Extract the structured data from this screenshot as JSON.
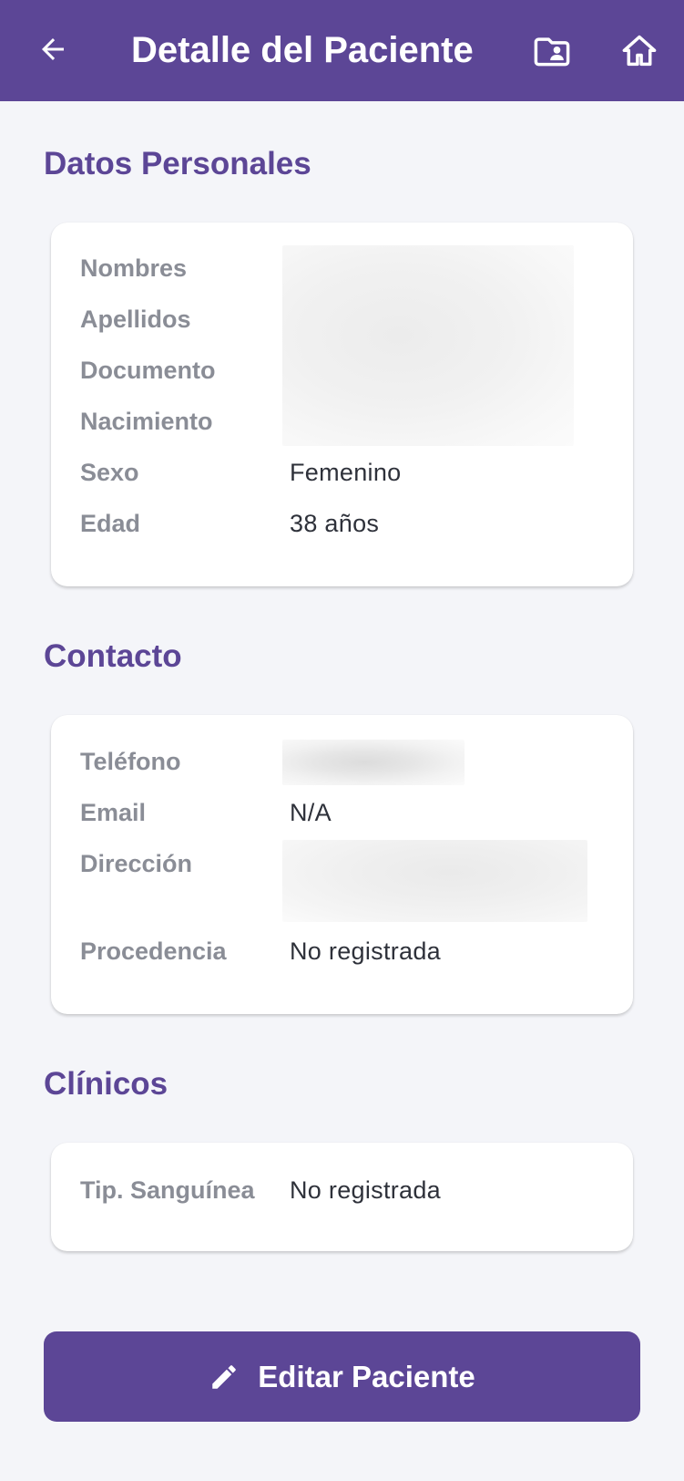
{
  "appbar": {
    "title": "Detalle del Paciente",
    "back_icon": "arrow-back-icon",
    "folder_icon": "folder-account-icon",
    "home_icon": "home-icon"
  },
  "sections": {
    "personal": {
      "title": "Datos Personales",
      "fields": [
        {
          "label": "Nombres",
          "value": ""
        },
        {
          "label": "Apellidos",
          "value": ""
        },
        {
          "label": "Documento",
          "value": ""
        },
        {
          "label": "Nacimiento",
          "value": ""
        },
        {
          "label": "Sexo",
          "value": "Femenino"
        },
        {
          "label": "Edad",
          "value": "38 años"
        }
      ]
    },
    "contact": {
      "title": "Contacto",
      "fields": [
        {
          "label": "Teléfono",
          "value": ""
        },
        {
          "label": "Email",
          "value": "N/A"
        },
        {
          "label": "Dirección",
          "value": ""
        },
        {
          "label": "Procedencia",
          "value": "No registrada"
        }
      ]
    },
    "clinical": {
      "title": "Clínicos",
      "fields": [
        {
          "label": "Tip. Sanguínea",
          "value": "No registrada"
        }
      ]
    }
  },
  "actions": {
    "edit_label": "Editar Paciente",
    "edit_icon": "pencil-icon"
  },
  "colors": {
    "primary": "#5c4696",
    "background": "#f4f5f9",
    "label": "#8a8d96",
    "value": "#2e313a"
  }
}
